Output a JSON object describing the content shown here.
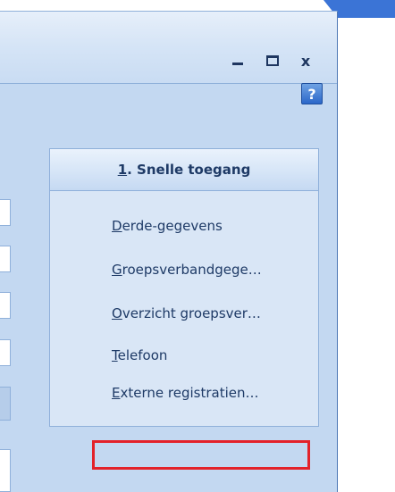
{
  "window": {
    "controls": {
      "minimize": "minimize",
      "restore": "restore",
      "close": "x"
    },
    "help": "?"
  },
  "quick_access": {
    "header_accel": "1",
    "header_rest": ". Snelle toegang",
    "links": [
      {
        "accel": "D",
        "rest": "erde-gegevens"
      },
      {
        "accel": "G",
        "rest": "roepsverbandgege…"
      },
      {
        "accel": "O",
        "rest": "verzicht groepsver…"
      },
      {
        "accel": "T",
        "rest": "elefoon"
      },
      {
        "accel": "E",
        "rest": "xterne registratien…"
      }
    ],
    "highlighted_index": 4
  },
  "colors": {
    "highlight": "#e3222a",
    "panel": "#d9e6f6",
    "link_text": "#1e3a66"
  }
}
